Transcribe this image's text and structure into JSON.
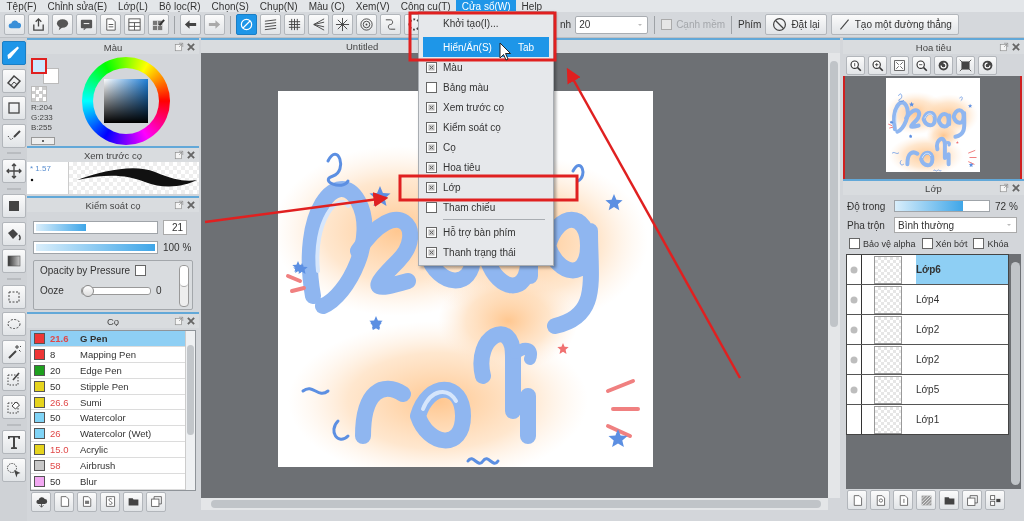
{
  "menubar": [
    {
      "label": "Tệp(F)",
      "selected": false
    },
    {
      "label": "Chỉnh sửa(E)",
      "selected": false
    },
    {
      "label": "Lớp(L)",
      "selected": false
    },
    {
      "label": "Bộ lọc(R)",
      "selected": false
    },
    {
      "label": "Chọn(S)",
      "selected": false
    },
    {
      "label": "Chụp(N)",
      "selected": false
    },
    {
      "label": "Màu (C)",
      "selected": false
    },
    {
      "label": "Xem(V)",
      "selected": false
    },
    {
      "label": "Công cụ(T)",
      "selected": false
    },
    {
      "label": "Cửa sổ(W)",
      "selected": true
    },
    {
      "label": "Help",
      "selected": false
    }
  ],
  "toolbar": {
    "snap_modes": [
      {
        "selected": true
      },
      {
        "selected": false
      },
      {
        "selected": false
      },
      {
        "selected": false
      },
      {
        "selected": false
      },
      {
        "selected": false
      },
      {
        "selected": false
      },
      {
        "selected": false
      }
    ],
    "width_label": "nh",
    "width_value": "20",
    "antialias": {
      "label": "Cạnh mềm",
      "checked": false,
      "disabled": true
    },
    "keys_label": "Phím",
    "reset_button": "Đặt lại",
    "line_button": "Tạo một đường thẳng"
  },
  "window_menu": {
    "items": [
      {
        "kind": "command",
        "label": "Khởi tạo(I)...",
        "selected": false
      },
      {
        "kind": "command",
        "label": "Hiển/Ẩn(S)",
        "shortcut": "Tab",
        "selected": true
      },
      {
        "kind": "check",
        "label": "Màu",
        "checked": true,
        "selected": false
      },
      {
        "kind": "check",
        "label": "Bảng màu",
        "checked": false,
        "selected": false
      },
      {
        "kind": "check",
        "label": "Xem trước cọ",
        "checked": true,
        "selected": false
      },
      {
        "kind": "check",
        "label": "Kiểm soát cọ",
        "checked": true,
        "selected": false
      },
      {
        "kind": "check",
        "label": "Cọ",
        "checked": true,
        "selected": false
      },
      {
        "kind": "check",
        "label": "Hoa tiêu",
        "checked": true,
        "selected": false
      },
      {
        "kind": "check",
        "label": "Lớp",
        "checked": true,
        "selected": false
      },
      {
        "kind": "check",
        "label": "Tham chiếu",
        "checked": false,
        "selected": false
      },
      {
        "kind": "separator"
      },
      {
        "kind": "check",
        "label": "Hỗ trợ bàn phím",
        "checked": true,
        "selected": false
      },
      {
        "kind": "check",
        "label": "Thanh trạng thái",
        "checked": true,
        "selected": false
      }
    ]
  },
  "tools": [
    {
      "selected": true
    },
    {
      "selected": false
    },
    {
      "selected": false
    },
    {
      "selected": false
    },
    {
      "selected": false
    },
    {
      "selected": false
    },
    {
      "selected": false
    },
    {
      "selected": false
    },
    {
      "selected": false
    },
    {
      "selected": false
    },
    {
      "selected": false
    },
    {
      "selected": false
    },
    {
      "selected": false
    },
    {
      "selected": false
    },
    {
      "selected": false
    }
  ],
  "color_panel": {
    "title": "Màu",
    "r": "R:204",
    "g": "G:233",
    "b": "B:255"
  },
  "brush_preview": {
    "title": "Xem trước cọ",
    "size": "* 1.57"
  },
  "brush_control": {
    "title": "Kiểm soát cọ",
    "size_slider": {
      "level": 0.42,
      "value": "21"
    },
    "opacity_slider": {
      "level": 1,
      "value": "100 %"
    },
    "pressure_option": {
      "label": "Opacity by Pressure",
      "checked": false
    },
    "ooze": {
      "label": "Ooze",
      "level": 0,
      "value": "0"
    }
  },
  "brushes": {
    "title": "Cọ",
    "items": [
      {
        "color": "#ee3636",
        "size": "21.6",
        "pressure": true,
        "name": "G Pen",
        "selected": true
      },
      {
        "color": "#ee3636",
        "size": "8",
        "pressure": false,
        "name": "Mapping Pen",
        "selected": false
      },
      {
        "color": "#1ea01e",
        "size": "20",
        "pressure": false,
        "name": "Edge Pen",
        "selected": false
      },
      {
        "color": "#e6d41e",
        "size": "50",
        "pressure": false,
        "name": "Stipple Pen",
        "selected": false
      },
      {
        "color": "#e6d41e",
        "size": "26.6",
        "pressure": true,
        "name": "Sumi",
        "selected": false
      },
      {
        "color": "#80d4f6",
        "size": "50",
        "pressure": false,
        "name": "Watercolor",
        "selected": false
      },
      {
        "color": "#80d4f6",
        "size": "26",
        "pressure": true,
        "name": "Watercolor (Wet)",
        "selected": false
      },
      {
        "color": "#e6d41e",
        "size": "15.0",
        "pressure": true,
        "name": "Acrylic",
        "selected": false
      },
      {
        "color": "#c8c8c8",
        "size": "58",
        "pressure": true,
        "name": "Airbrush",
        "selected": false
      },
      {
        "color": "#f2a8f2",
        "size": "50",
        "pressure": false,
        "name": "Blur",
        "selected": false
      }
    ]
  },
  "canvas": {
    "title": "Untitled"
  },
  "navigator": {
    "title": "Hoa tiêu"
  },
  "layers": {
    "title": "Lớp",
    "opacity_label": "Độ trong",
    "opacity": {
      "level": 0.72,
      "value": "72 %"
    },
    "blend_label": "Pha trộn",
    "blend_mode": "Bình thường",
    "options": [
      {
        "label": "Bảo vệ alpha",
        "checked": false
      },
      {
        "label": "Xén bớt",
        "checked": false
      },
      {
        "label": "Khóa",
        "checked": false
      }
    ],
    "items": [
      {
        "name": "Lớp6",
        "visible": true,
        "selected": true
      },
      {
        "name": "Lớp4",
        "visible": true,
        "selected": false
      },
      {
        "name": "Lớp2",
        "visible": true,
        "selected": false
      },
      {
        "name": "Lớp2",
        "visible": true,
        "selected": false
      },
      {
        "name": "Lớp5",
        "visible": true,
        "selected": false
      },
      {
        "name": "Lớp1",
        "visible": false,
        "selected": false
      }
    ]
  }
}
